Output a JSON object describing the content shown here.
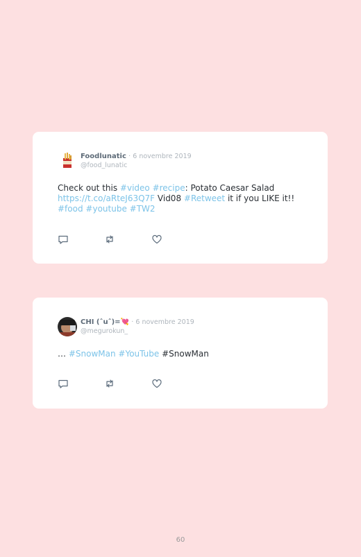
{
  "tweets": [
    {
      "name": "Foodlunatic",
      "date_sep": "·",
      "date": "6 novembre 2019",
      "handle": "@food_lunatic",
      "segments": [
        {
          "text": "Check out this ",
          "link": false
        },
        {
          "text": "#video",
          "link": true
        },
        {
          "text": " ",
          "link": false
        },
        {
          "text": "#recipe",
          "link": true
        },
        {
          "text": ": Potato Caesar Salad ",
          "link": false
        },
        {
          "text": "https://t.co/aRteJ63Q7F",
          "link": true
        },
        {
          "text": " Vid08 ",
          "link": false
        },
        {
          "text": "#Retweet",
          "link": true
        },
        {
          "text": " it if you LIKE it!! ",
          "link": false
        },
        {
          "text": "#food",
          "link": true
        },
        {
          "text": " ",
          "link": false
        },
        {
          "text": "#youtube",
          "link": true
        },
        {
          "text": " ",
          "link": false
        },
        {
          "text": "#TW2",
          "link": true
        }
      ]
    },
    {
      "name": "CHI (ˆuˆ)=💘",
      "date_sep": "·",
      "date": "6 novembre 2019",
      "handle": "@megurokun_",
      "segments": [
        {
          "text": "… ",
          "link": false
        },
        {
          "text": "#SnowMan",
          "link": true
        },
        {
          "text": " ",
          "link": false
        },
        {
          "text": "#YouTube",
          "link": true
        },
        {
          "text": " #SnowMan",
          "link": false
        }
      ]
    }
  ],
  "icons": [
    "reply-icon",
    "retweet-icon",
    "like-icon"
  ],
  "colors": {
    "background": "#fde0e1",
    "card": "#ffffff",
    "link": "#7cc3e8",
    "icon": "#5b6b7b"
  },
  "page_number": "60"
}
